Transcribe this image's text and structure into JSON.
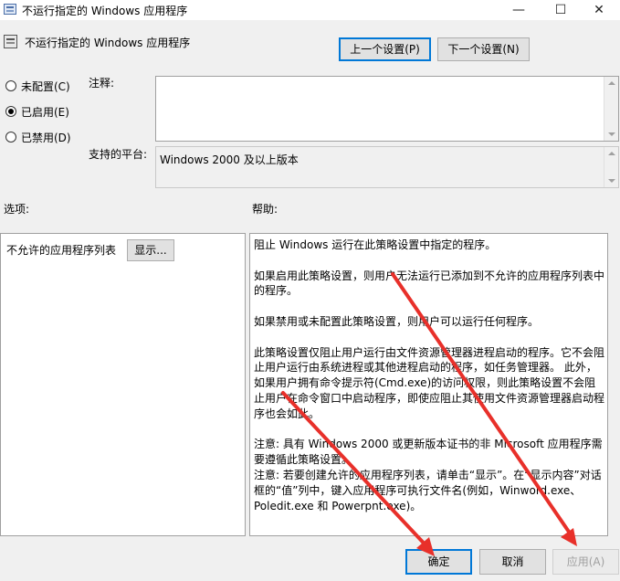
{
  "window": {
    "title": "不运行指定的 Windows 应用程序",
    "minimize_glyph": "—",
    "maximize_glyph": "☐",
    "close_glyph": "✕"
  },
  "policy": {
    "title": "不运行指定的 Windows 应用程序",
    "prev_label": "上一个设置(P)",
    "next_label": "下一个设置(N)"
  },
  "state": {
    "options": [
      {
        "label": "未配置(C)",
        "checked": false
      },
      {
        "label": "已启用(E)",
        "checked": true
      },
      {
        "label": "已禁用(D)",
        "checked": false
      }
    ]
  },
  "comment": {
    "label": "注释:",
    "value": ""
  },
  "platform": {
    "label": "支持的平台:",
    "value": "Windows 2000 及以上版本"
  },
  "options_panel": {
    "label": "选项:",
    "item_label": "不允许的应用程序列表",
    "show_button": "显示..."
  },
  "help_panel": {
    "label": "帮助:",
    "paragraphs": [
      "阻止 Windows 运行在此策略设置中指定的程序。",
      "如果启用此策略设置，则用户无法运行已添加到不允许的应用程序列表中的程序。",
      "如果禁用或未配置此策略设置，则用户可以运行任何程序。",
      "此策略设置仅阻止用户运行由文件资源管理器进程启动的程序。它不会阻止用户运行由系统进程或其他进程启动的程序，如任务管理器。 此外，如果用户拥有命令提示符(Cmd.exe)的访问权限，则此策略设置不会阻止用户在命令窗口中启动程序，即使应阻止其使用文件资源管理器启动程序也会如此。",
      "注意: 具有 Windows 2000 或更新版本证书的非 Microsoft 应用程序需要遵循此策略设置。",
      "注意: 若要创建允许的应用程序列表，请单击“显示”。在“显示内容”对话框的“值”列中，键入应用程序可执行文件名(例如，Winword.exe、Poledit.exe 和 Powerpnt.exe)。"
    ]
  },
  "footer": {
    "ok_label": "确定",
    "cancel_label": "取消",
    "apply_label": "应用(A)"
  },
  "colors": {
    "annotation_arrow": "#e8302a",
    "focus_border": "#0078d7"
  }
}
